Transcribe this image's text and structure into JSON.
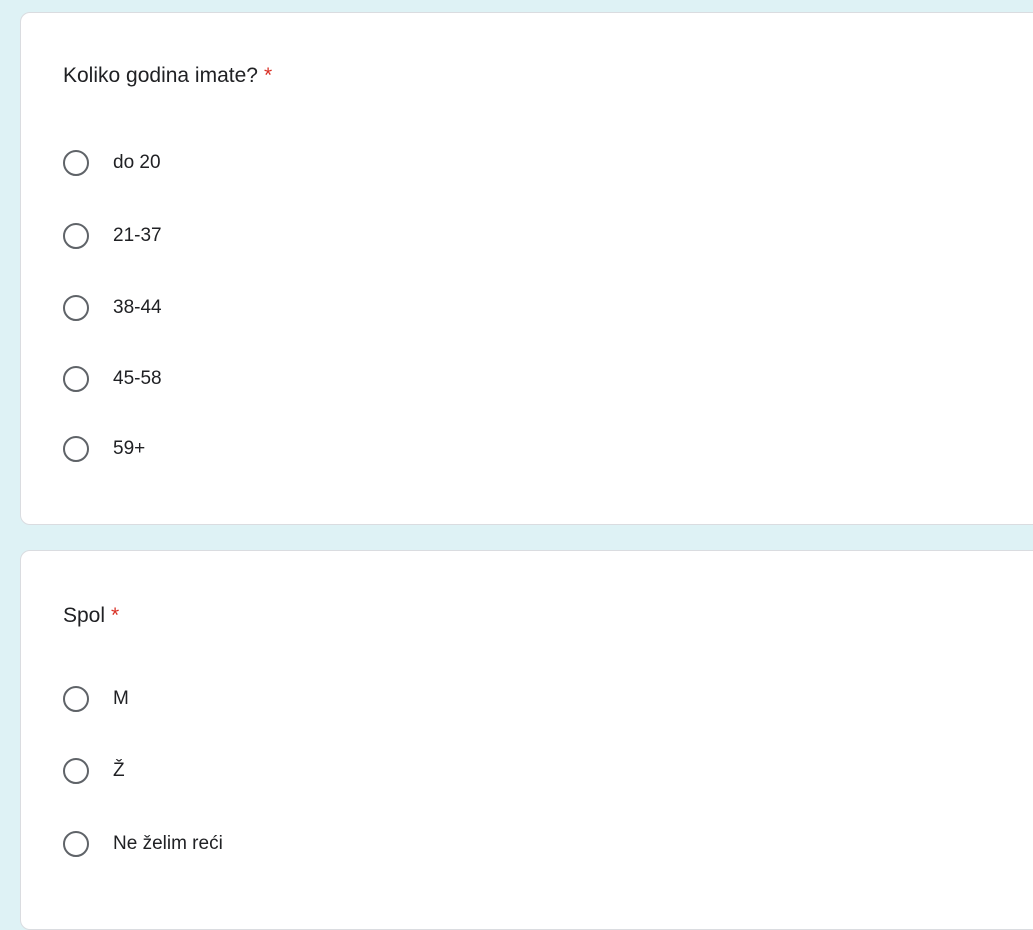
{
  "questions": [
    {
      "title": "Koliko godina imate?",
      "required_mark": "*",
      "options": [
        "do 20",
        "21-37",
        "38-44",
        "45-58",
        "59+"
      ]
    },
    {
      "title": "Spol",
      "required_mark": "*",
      "options": [
        "M",
        "Ž",
        "Ne želim reći"
      ]
    }
  ],
  "colors": {
    "page_background": "#def2f5",
    "card_background": "#ffffff",
    "required_star": "#d93025",
    "radio_border": "#5f6368",
    "text": "#202124"
  }
}
